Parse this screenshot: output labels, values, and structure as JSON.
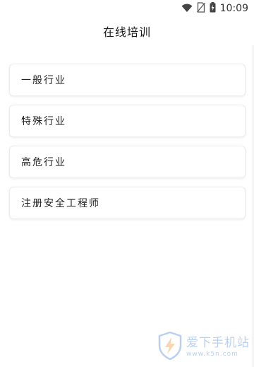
{
  "status_bar": {
    "time": "10:09",
    "icons": [
      "wifi-icon",
      "no-sim-icon",
      "battery-charging-icon"
    ]
  },
  "header": {
    "title": "在线培训"
  },
  "menu": {
    "items": [
      {
        "label": "一般行业"
      },
      {
        "label": "特殊行业"
      },
      {
        "label": "高危行业"
      },
      {
        "label": "注册安全工程师"
      }
    ]
  },
  "watermark": {
    "title": "爱下手机站",
    "url": "www.k5n.com",
    "accent_color": "#3a7bd5"
  }
}
